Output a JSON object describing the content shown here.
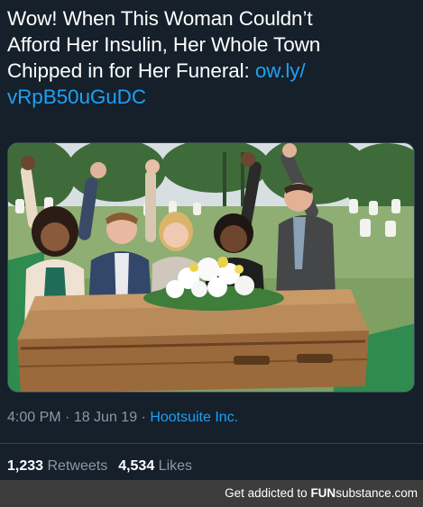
{
  "tweet": {
    "text_line1": "Wow! When This Woman Couldn’t",
    "text_line2": "Afford Her Insulin, Her Whole Town",
    "text_line3": "Chipped in for Her Funeral: ",
    "link_part1": "ow.ly/",
    "link_part2": "vRpB50uGuDC",
    "time": "4:00 PM",
    "separator": " · ",
    "date": "18 Jun 19",
    "source": "Hootsuite Inc."
  },
  "stats": {
    "retweets_count": "1,233",
    "retweets_label": " Retweets",
    "likes_count": "4,534",
    "likes_label": " Likes"
  },
  "watermark": {
    "prefix": "Get addicted to ",
    "brand_fun": "FUN",
    "brand_sub": "substance",
    "suffix": ".com"
  },
  "colors": {
    "background": "#15202b",
    "link": "#1da1f2",
    "muted": "#8899a6",
    "divider": "#38444d"
  }
}
